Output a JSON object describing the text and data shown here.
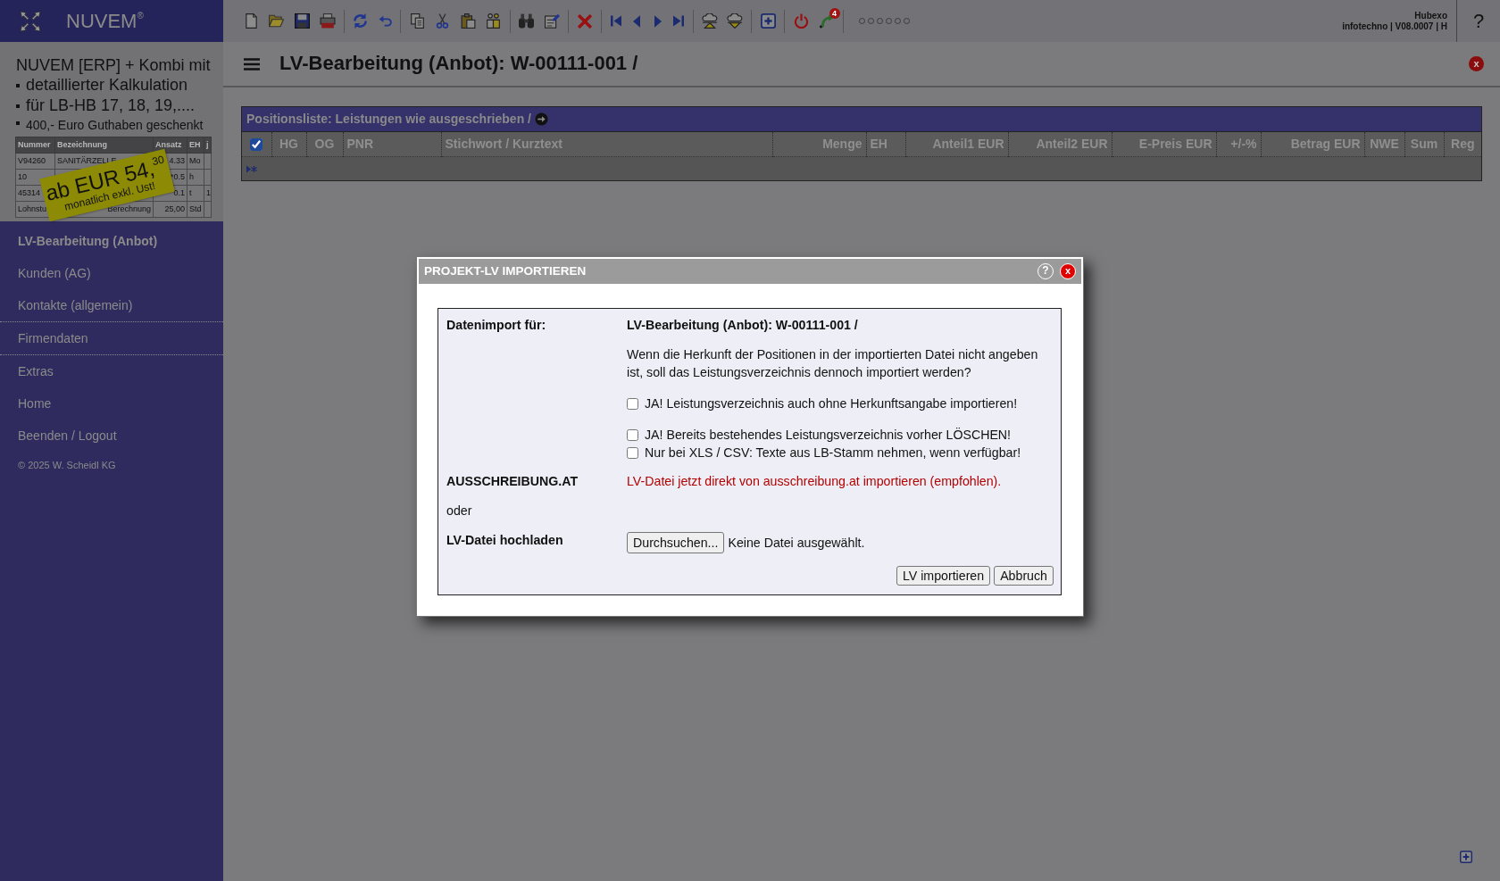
{
  "sidebar": {
    "logo": "NUVEM$^{®}$",
    "ad": {
      "headline": "NUVEM [ERP] + Kombi mit",
      "bullets": [
        "detaillierter Kalkulation",
        "für LB-HB 17, 18, 19,....",
        "400,- Euro Guthaben geschenkt"
      ],
      "table": {
        "columns": [
          "Nummer",
          "Bezeichnung",
          "Ansatz",
          "EH",
          "j"
        ],
        "rows": [
          [
            "V94260",
            "SANITÄRZELLE",
            "4.33",
            "Mo",
            null
          ],
          [
            "10",
            null,
            "*0.5",
            "h",
            null
          ],
          [
            "45314",
            null,
            "0.1",
            "t",
            "1"
          ],
          [
            "Lohnstu",
            "Berechnung",
            "25,00",
            "Std",
            null
          ]
        ]
      },
      "sticker": {
        "price": "ab EUR 54,$^{30}$",
        "note": "monatlich exkl. Ust!"
      }
    },
    "menu": {
      "groups": [
        {
          "items": [
            {
              "label": "LV-Bearbeitung (Anbot)",
              "selected": true
            },
            {
              "label": "Kunden (AG)",
              "selected": false
            },
            {
              "label": "Kontakte (allgemein)",
              "selected": false
            }
          ]
        },
        {
          "items": [
            {
              "label": "Firmendaten",
              "selected": false
            }
          ]
        },
        {
          "items": [
            {
              "label": "Extras",
              "selected": false
            },
            {
              "label": "Home",
              "selected": false
            },
            {
              "label": "Beenden / Logout",
              "selected": false
            }
          ]
        }
      ]
    },
    "copyright": "© 2025 W. Scheidl KG"
  },
  "toolbar": {
    "groups": [
      {
        "buttons": [
          {
            "kind": "new"
          },
          {
            "kind": "open"
          },
          {
            "kind": "save"
          },
          {
            "kind": "pdf"
          }
        ]
      },
      {
        "buttons": [
          {
            "kind": "refresh"
          },
          {
            "kind": "undo"
          }
        ]
      },
      {
        "buttons": [
          {
            "kind": "copy"
          },
          {
            "kind": "cut"
          },
          {
            "kind": "paste"
          },
          {
            "kind": "people"
          }
        ]
      },
      {
        "buttons": [
          {
            "kind": "find"
          },
          {
            "kind": "edit"
          }
        ]
      },
      {
        "buttons": [
          {
            "kind": "delete"
          }
        ]
      },
      {
        "buttons": [
          {
            "kind": "first"
          },
          {
            "kind": "prev"
          },
          {
            "kind": "next"
          },
          {
            "kind": "last"
          }
        ]
      },
      {
        "buttons": [
          {
            "kind": "upload"
          },
          {
            "kind": "download"
          }
        ]
      },
      {
        "buttons": [
          {
            "kind": "add"
          }
        ]
      },
      {
        "buttons": [
          {
            "kind": "power"
          },
          {
            "kind": "return",
            "badge": "4"
          }
        ]
      }
    ],
    "status_dots": [
      {
        "filled": false
      },
      {
        "filled": false
      },
      {
        "filled": false
      },
      {
        "filled": false
      },
      {
        "filled": false
      },
      {
        "filled": false
      }
    ],
    "user": "Hubexo",
    "info": "infotechno | V08.0007 | H",
    "help": "?"
  },
  "page": {
    "title": "LV-Bearbeitung (Anbot): W-00111-001 /",
    "close": "x"
  },
  "positions": {
    "title": "Positionsliste: Leistungen wie ausgeschrieben /",
    "select_all": {
      "checked": true
    },
    "columns": [
      "HG",
      "OG",
      "PNR",
      "Stichwort / Kurztext",
      "Menge",
      "EH",
      "Anteil1 EUR",
      "Anteil2 EUR",
      "E-Preis EUR",
      "+/-%",
      "Betrag EUR",
      "NWE",
      "Sum",
      "Reg"
    ]
  },
  "dialog": {
    "title": "PROJEKT-LV IMPORTIEREN",
    "help": "?",
    "close": "x",
    "target_label": "Datenimport für:",
    "target_value": "LV-Bearbeitung (Anbot): W-00111-001 /",
    "question": "Wenn die Herkunft der Positionen in der importierten Datei nicht angeben ist, soll das Leistungsverzeichnis dennoch importiert werden?",
    "options": [
      {
        "label": "JA! Leistungsverzeichnis auch ohne Herkunftsangabe importieren!",
        "checked": false
      },
      {
        "label": "JA! Bereits bestehendes Leistungsverzeichnis vorher LÖSCHEN!",
        "checked": false
      },
      {
        "label": "Nur bei XLS / CSV: Texte aus LB-Stamm nehmen, wenn verfügbar!",
        "checked": false
      }
    ],
    "source_label": "AUSSCHREIBUNG.AT",
    "source_link": "LV-Datei jetzt direkt von ausschreibung.at importieren (empfohlen).",
    "separator": "oder",
    "upload_label": "LV-Datei hochladen",
    "file_button": "Durchsuchen...",
    "file_status": "Keine Datei ausgewählt.",
    "buttons": [
      "LV importieren",
      "Abbruch"
    ]
  }
}
